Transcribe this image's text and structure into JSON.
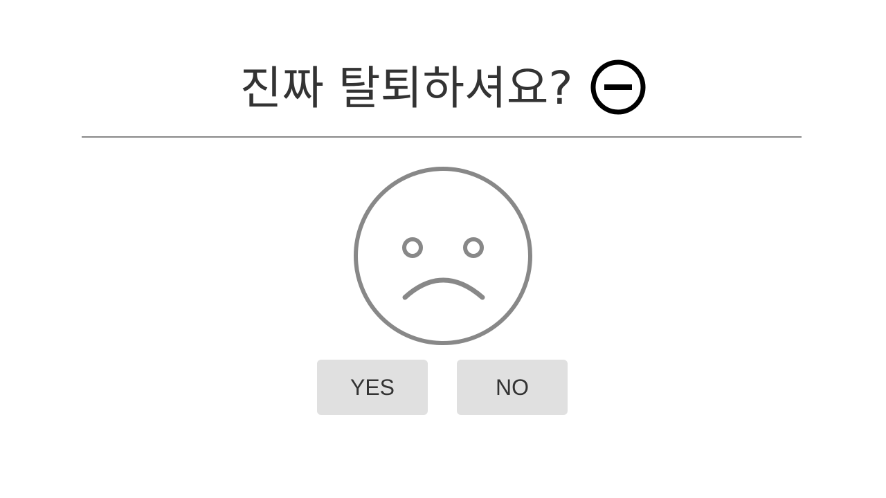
{
  "dialog": {
    "title": "진짜 탈퇴하셔요?",
    "title_icon": "minus-circle-icon",
    "illustration_icon": "sad-face-icon",
    "yes_label": "YES",
    "no_label": "NO"
  },
  "colors": {
    "text": "#333333",
    "divider": "#888888",
    "face": "#888888",
    "button_bg": "#e0e0e0"
  }
}
